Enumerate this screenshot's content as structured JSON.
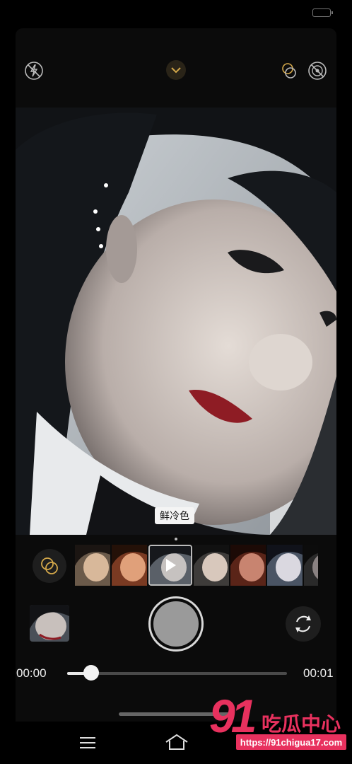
{
  "status_bar": {
    "battery_icon": "battery-icon"
  },
  "top_controls": {
    "flash_icon": "flash-off-icon",
    "expand_icon": "chevron-down-icon",
    "filters_icon": "filter-rings-icon",
    "live_icon": "live-off-icon"
  },
  "preview": {
    "filter_name": "鲜冷色"
  },
  "filter_strip": {
    "selected_index": 2,
    "play_icon": "play-icon",
    "count": 7
  },
  "bottom_controls": {
    "filter_button_icon": "filter-rings-icon",
    "shutter_icon": "shutter-button",
    "switch_camera_icon": "switch-camera-icon",
    "gallery_icon": "gallery-thumbnail"
  },
  "playback": {
    "current_time": "00:00",
    "total_time": "00:01",
    "progress": 0.11
  },
  "navbar": {
    "menu_icon": "menu-icon",
    "home_icon": "home-icon"
  },
  "watermark": {
    "logo_number": "91",
    "logo_text": "吃瓜中心",
    "url": "https://91chigua17.com"
  },
  "colors": {
    "accent_gold": "#d4a84a",
    "watermark_pink": "#e8315e"
  }
}
